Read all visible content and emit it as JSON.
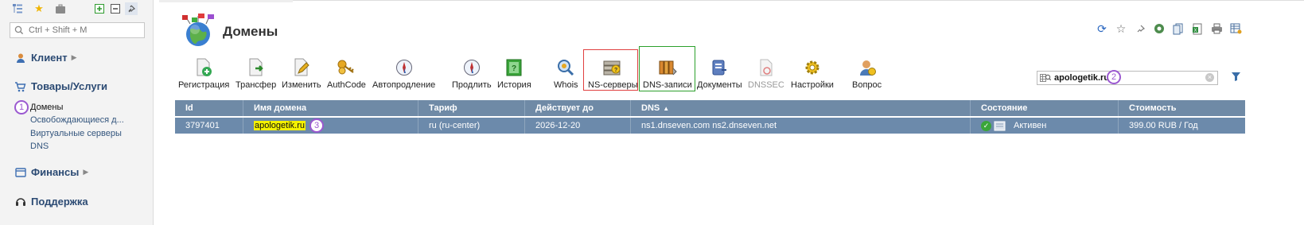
{
  "sidebar": {
    "search_placeholder": "Ctrl + Shift + M",
    "sections": [
      {
        "label": "Клиент"
      },
      {
        "label": "Товары/Услуги"
      },
      {
        "label": "Финансы"
      },
      {
        "label": "Поддержка"
      }
    ],
    "goods_items": [
      {
        "label": "Домены",
        "active": true
      },
      {
        "label": "Освобождающиеся д..."
      },
      {
        "label": "Виртуальные серверы"
      },
      {
        "label": "DNS"
      }
    ]
  },
  "header": {
    "title": "Домены"
  },
  "toolbar": [
    {
      "label": "Регистрация",
      "icon": "register-icon"
    },
    {
      "label": "Трансфер",
      "icon": "transfer-icon"
    },
    {
      "label": "Изменить",
      "icon": "edit-icon"
    },
    {
      "label": "AuthCode",
      "icon": "key-icon"
    },
    {
      "label": "Автопродление",
      "icon": "compass-icon"
    },
    {
      "label": "Продлить",
      "icon": "compass-icon"
    },
    {
      "label": "История",
      "icon": "history-icon"
    },
    {
      "label": "Whois",
      "icon": "magnifier-icon"
    },
    {
      "label": "NS-серверы",
      "icon": "server-icon"
    },
    {
      "label": "DNS-записи",
      "icon": "dns-records-icon"
    },
    {
      "label": "Документы",
      "icon": "documents-icon"
    },
    {
      "label": "DNSSEC",
      "icon": "dnssec-icon",
      "disabled": true
    },
    {
      "label": "Настройки",
      "icon": "gear-icon"
    },
    {
      "label": "Вопрос",
      "icon": "question-user-icon"
    }
  ],
  "filter": {
    "value": "apologetik.ru"
  },
  "badges": {
    "one": "1",
    "two": "2",
    "three": "3"
  },
  "table": {
    "columns": [
      "Id",
      "Имя домена",
      "Тариф",
      "Действует до",
      "DNS",
      "Состояние",
      "Стоимость"
    ],
    "rows": [
      {
        "id": "3797401",
        "domain": "apologetik.ru",
        "tariff": "ru (ru-center)",
        "valid_until": "2026-12-20",
        "dns": "ns1.dnseven.com ns2.dnseven.net",
        "status": "Активен",
        "price": "399.00 RUB / Год"
      }
    ]
  },
  "colors": {
    "header_bg": "#6f8aa6",
    "selected_row": "#6c8aab",
    "badge": "#9b59d0",
    "highlight": "#f4f100"
  }
}
